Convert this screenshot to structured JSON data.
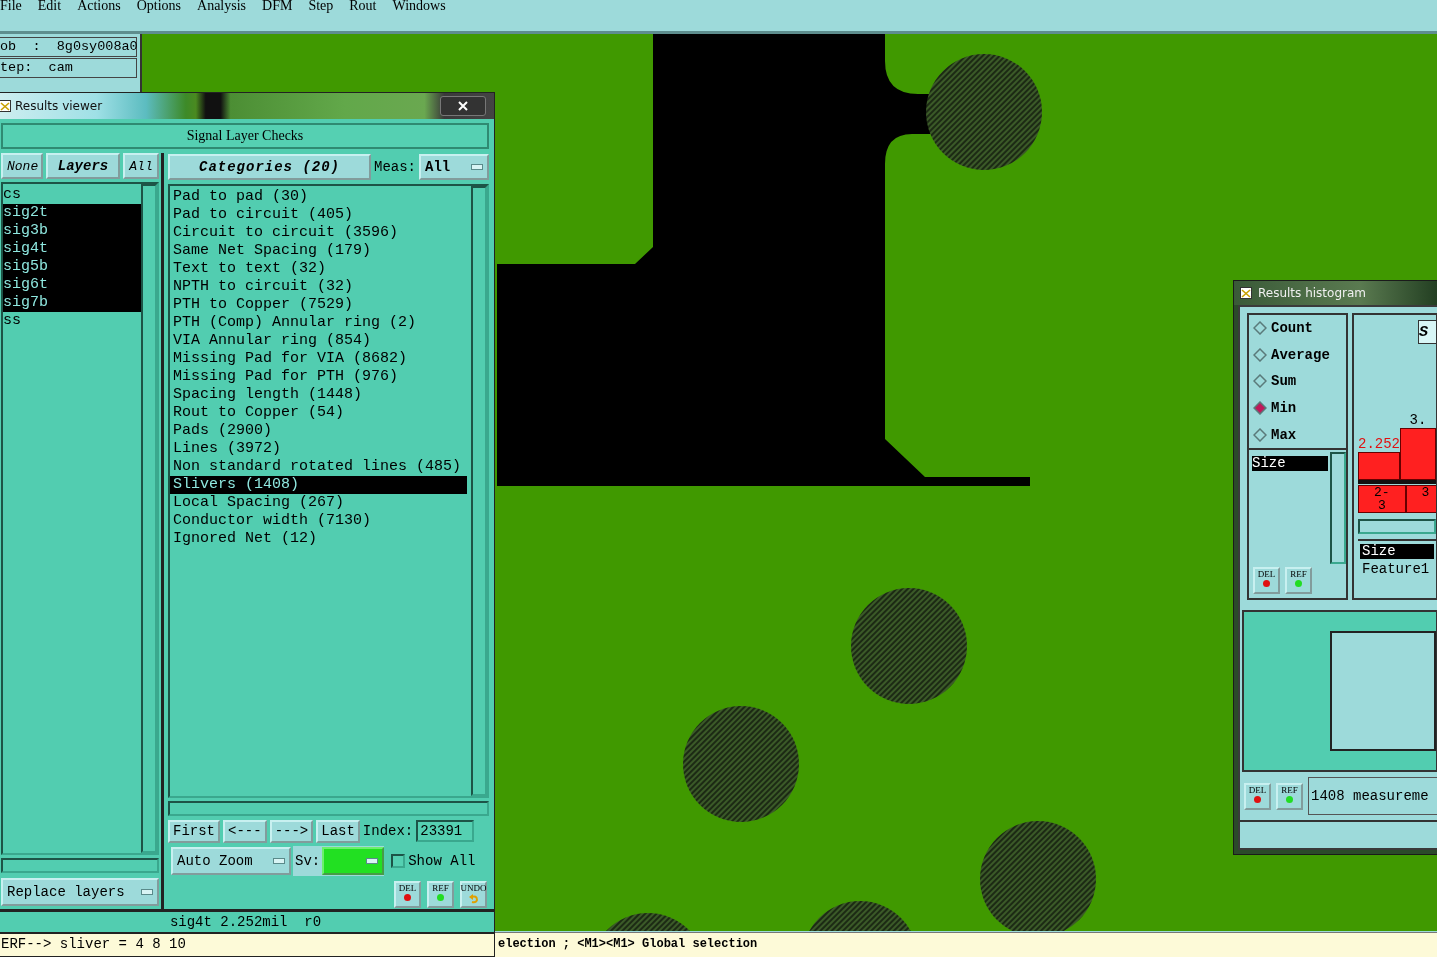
{
  "menu": [
    "File",
    "Edit",
    "Actions",
    "Options",
    "Analysis",
    "DFM",
    "Step",
    "Rout",
    "Windows"
  ],
  "job_info": [
    "ob  :  8g0sy008a0",
    "tep:  cam"
  ],
  "results_viewer": {
    "title": "Results viewer",
    "header": "Signal Layer Checks",
    "layer_buttons": [
      "None",
      "Layers",
      "All"
    ],
    "layers": [
      {
        "name": "cs",
        "selected": false
      },
      {
        "name": "sig2t",
        "selected": true
      },
      {
        "name": "sig3b",
        "selected": true
      },
      {
        "name": "sig4t",
        "selected": true
      },
      {
        "name": "sig5b",
        "selected": true
      },
      {
        "name": "sig6t",
        "selected": true
      },
      {
        "name": "sig7b",
        "selected": true
      },
      {
        "name": "ss",
        "selected": false
      }
    ],
    "replace_mode": "Replace layers",
    "categories_button": "Categories (20)",
    "meas_label": "Meas:",
    "meas_value": "All",
    "categories": [
      {
        "name": "Pad to pad (30)",
        "selected": false
      },
      {
        "name": "Pad to circuit (405)",
        "selected": false
      },
      {
        "name": "Circuit to circuit (3596)",
        "selected": false
      },
      {
        "name": "Same Net Spacing (179)",
        "selected": false
      },
      {
        "name": "Text to text (32)",
        "selected": false
      },
      {
        "name": "NPTH to circuit (32)",
        "selected": false
      },
      {
        "name": "PTH to Copper (7529)",
        "selected": false
      },
      {
        "name": "PTH (Comp) Annular ring (2)",
        "selected": false
      },
      {
        "name": "VIA Annular ring (854)",
        "selected": false
      },
      {
        "name": "Missing Pad for VIA (8682)",
        "selected": false
      },
      {
        "name": "Missing Pad for PTH (976)",
        "selected": false
      },
      {
        "name": "Spacing length (1448)",
        "selected": false
      },
      {
        "name": "Rout to Copper (54)",
        "selected": false
      },
      {
        "name": "Pads (2900)",
        "selected": false
      },
      {
        "name": "Lines (3972)",
        "selected": false
      },
      {
        "name": "Non standard rotated lines (485)",
        "selected": false
      },
      {
        "name": "Slivers (1408)",
        "selected": true
      },
      {
        "name": "Local Spacing (267)",
        "selected": false
      },
      {
        "name": "Conductor width (7130)",
        "selected": false
      },
      {
        "name": "Ignored Net (12)",
        "selected": false
      }
    ],
    "nav_buttons": [
      "First",
      "<---",
      "--->",
      "Last"
    ],
    "index_label": "Index:",
    "index_value": "23391",
    "zoom_mode": "Auto Zoom",
    "sv_label": "Sv:",
    "show_all": {
      "label": "Show All",
      "checked": false
    },
    "action_buttons": [
      {
        "label": "DEL",
        "kind": "delete"
      },
      {
        "label": "REF",
        "kind": "refresh"
      },
      {
        "label": "UNDO",
        "kind": "undo"
      }
    ],
    "status": "sig4t 2.252mil  r0",
    "message": "ERF--> sliver = 4 8 10"
  },
  "command_line": "election ; <M1><M1> Global selection",
  "histogram": {
    "title": "Results histogram",
    "modes": [
      {
        "label": "Count",
        "selected": false
      },
      {
        "label": "Average",
        "selected": false
      },
      {
        "label": "Sum",
        "selected": false
      },
      {
        "label": "Min",
        "selected": true
      },
      {
        "label": "Max",
        "selected": false
      }
    ],
    "attributes": [
      {
        "name": "Size",
        "selected": true
      }
    ],
    "attribute_buttons": [
      {
        "label": "DEL",
        "kind": "delete"
      },
      {
        "label": "REF",
        "kind": "refresh"
      }
    ],
    "corner_button": "S",
    "bars": [
      {
        "value": "2.252",
        "range": "2-3",
        "selected": true
      },
      {
        "value": "3.",
        "range": "3",
        "selected": false
      }
    ],
    "fields": [
      {
        "name": "Size",
        "selected": true
      },
      {
        "name": "Feature1",
        "selected": false
      }
    ],
    "bottom_buttons": [
      {
        "label": "DEL",
        "kind": "delete"
      },
      {
        "label": "REF",
        "kind": "refresh"
      }
    ],
    "summary": "1408 measureme"
  }
}
